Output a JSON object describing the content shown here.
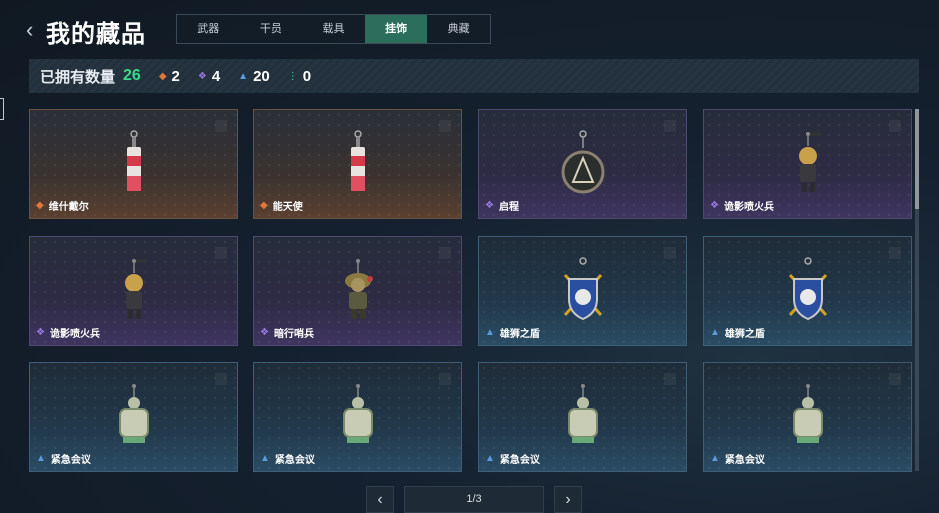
{
  "header": {
    "back_icon": "chevron-left-icon",
    "title": "我的藏品"
  },
  "tabs": [
    {
      "label": "武器",
      "active": false
    },
    {
      "label": "干员",
      "active": false
    },
    {
      "label": "载具",
      "active": false
    },
    {
      "label": "挂饰",
      "active": true
    },
    {
      "label": "典藏",
      "active": false
    }
  ],
  "stats": {
    "label": "已拥有数量",
    "total": "26",
    "counts": [
      {
        "icon": "orange-rarity-icon",
        "value": "2",
        "color": "#e07a3a"
      },
      {
        "icon": "purple-rarity-icon",
        "value": "4",
        "color": "#9b7be8"
      },
      {
        "icon": "blue-rarity-icon",
        "value": "20",
        "color": "#5a9be0"
      },
      {
        "icon": "green-rarity-icon",
        "value": "0",
        "color": "#39d98a"
      }
    ]
  },
  "items": [
    {
      "name": "维什戴尔",
      "rarity": "orange",
      "pic": "lighter"
    },
    {
      "name": "能天使",
      "rarity": "orange",
      "pic": "lighter"
    },
    {
      "name": "启程",
      "rarity": "purple",
      "pic": "medal"
    },
    {
      "name": "诡影喷火兵",
      "rarity": "purple",
      "pic": "soldier"
    },
    {
      "name": "诡影喷火兵",
      "rarity": "purple",
      "pic": "soldier"
    },
    {
      "name": "暗行哨兵",
      "rarity": "purple",
      "pic": "sentry"
    },
    {
      "name": "雄狮之盾",
      "rarity": "blue",
      "pic": "shield"
    },
    {
      "name": "雄狮之盾",
      "rarity": "blue",
      "pic": "shield"
    },
    {
      "name": "紧急会议",
      "rarity": "blue",
      "pic": "meeting"
    },
    {
      "name": "紧急会议",
      "rarity": "blue",
      "pic": "meeting"
    },
    {
      "name": "紧急会议",
      "rarity": "blue",
      "pic": "meeting"
    },
    {
      "name": "紧急会议",
      "rarity": "blue",
      "pic": "meeting"
    }
  ],
  "pager": {
    "label": "1/3",
    "prev_icon": "chevron-left-icon",
    "next_icon": "chevron-right-icon"
  }
}
